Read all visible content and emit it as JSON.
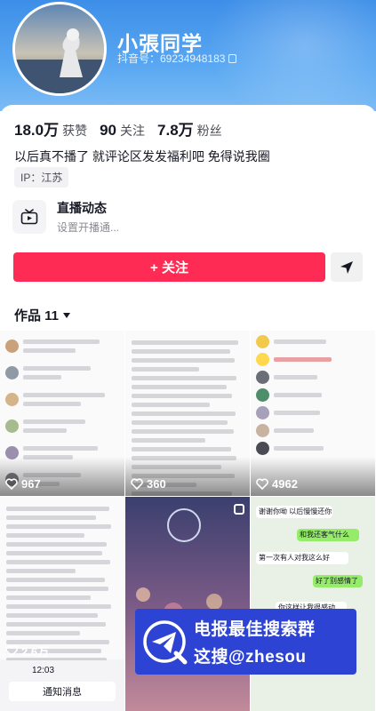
{
  "profile": {
    "nickname": "小張同学",
    "douyin_id": "抖音号：69234948183"
  },
  "stats": [
    {
      "value": "18.0万",
      "label": "获赞"
    },
    {
      "value": "90",
      "label": "关注"
    },
    {
      "value": "7.8万",
      "label": "粉丝"
    }
  ],
  "bio": "以后真不播了 就评论区发发福利吧 免得说我圈",
  "ip": "IP：江苏",
  "live": {
    "title": "直播动态",
    "subtitle": "设置开播通..."
  },
  "actions": {
    "follow_label": "+ 关注",
    "send_icon": "send-arrow-icon"
  },
  "works_tab": {
    "label": "作品 11"
  },
  "videos": [
    {
      "likes": "967"
    },
    {
      "likes": "360"
    },
    {
      "likes": "4962"
    },
    {
      "likes": "2.6万"
    },
    {
      "likes": ""
    },
    {
      "likes": ""
    }
  ],
  "tile_texts": {
    "chat_1": "谢谢你呦 以后慢慢还你",
    "chat_2": "和我还客气什么",
    "chat_3": "第一次有人对我这么好",
    "chat_4": "好了别感情了",
    "chat_5": "你这样让我很感动",
    "time": "12:03",
    "notice": "通知消息"
  },
  "watermark": {
    "line1": "电报最佳搜索群",
    "line2": "这搜@zhesou"
  },
  "colors": {
    "accent": "#fe2c55",
    "banner": "#4a9af0",
    "watermark": "#2d43d4"
  }
}
